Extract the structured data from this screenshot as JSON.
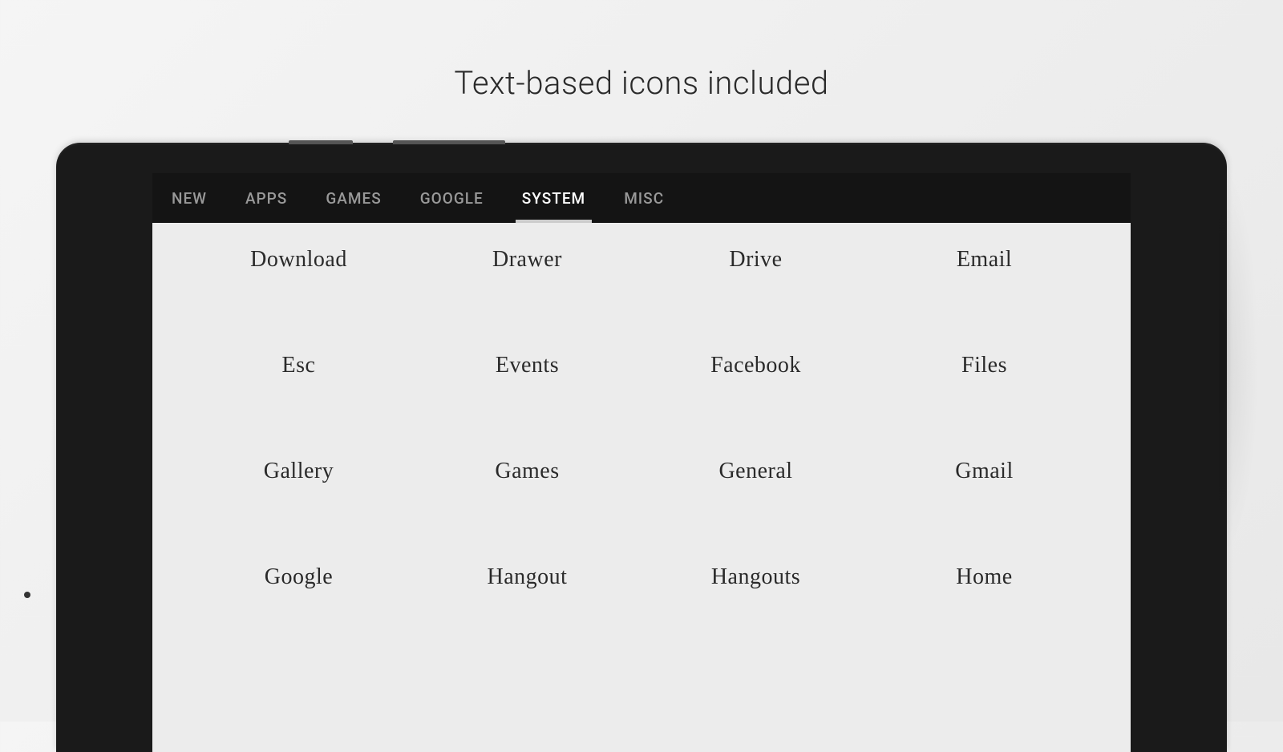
{
  "banner": {
    "title": "Text-based icons included"
  },
  "tabs": [
    {
      "label": "NEW",
      "active": false
    },
    {
      "label": "APPS",
      "active": false
    },
    {
      "label": "GAMES",
      "active": false
    },
    {
      "label": "GOOGLE",
      "active": false
    },
    {
      "label": "SYSTEM",
      "active": true
    },
    {
      "label": "MISC",
      "active": false
    }
  ],
  "icons": [
    "Download",
    "Drawer",
    "Drive",
    "Email",
    "Esc",
    "Events",
    "Facebook",
    "Files",
    "Gallery",
    "Games",
    "General",
    "Gmail",
    "Google",
    "Hangout",
    "Hangouts",
    "Home"
  ]
}
